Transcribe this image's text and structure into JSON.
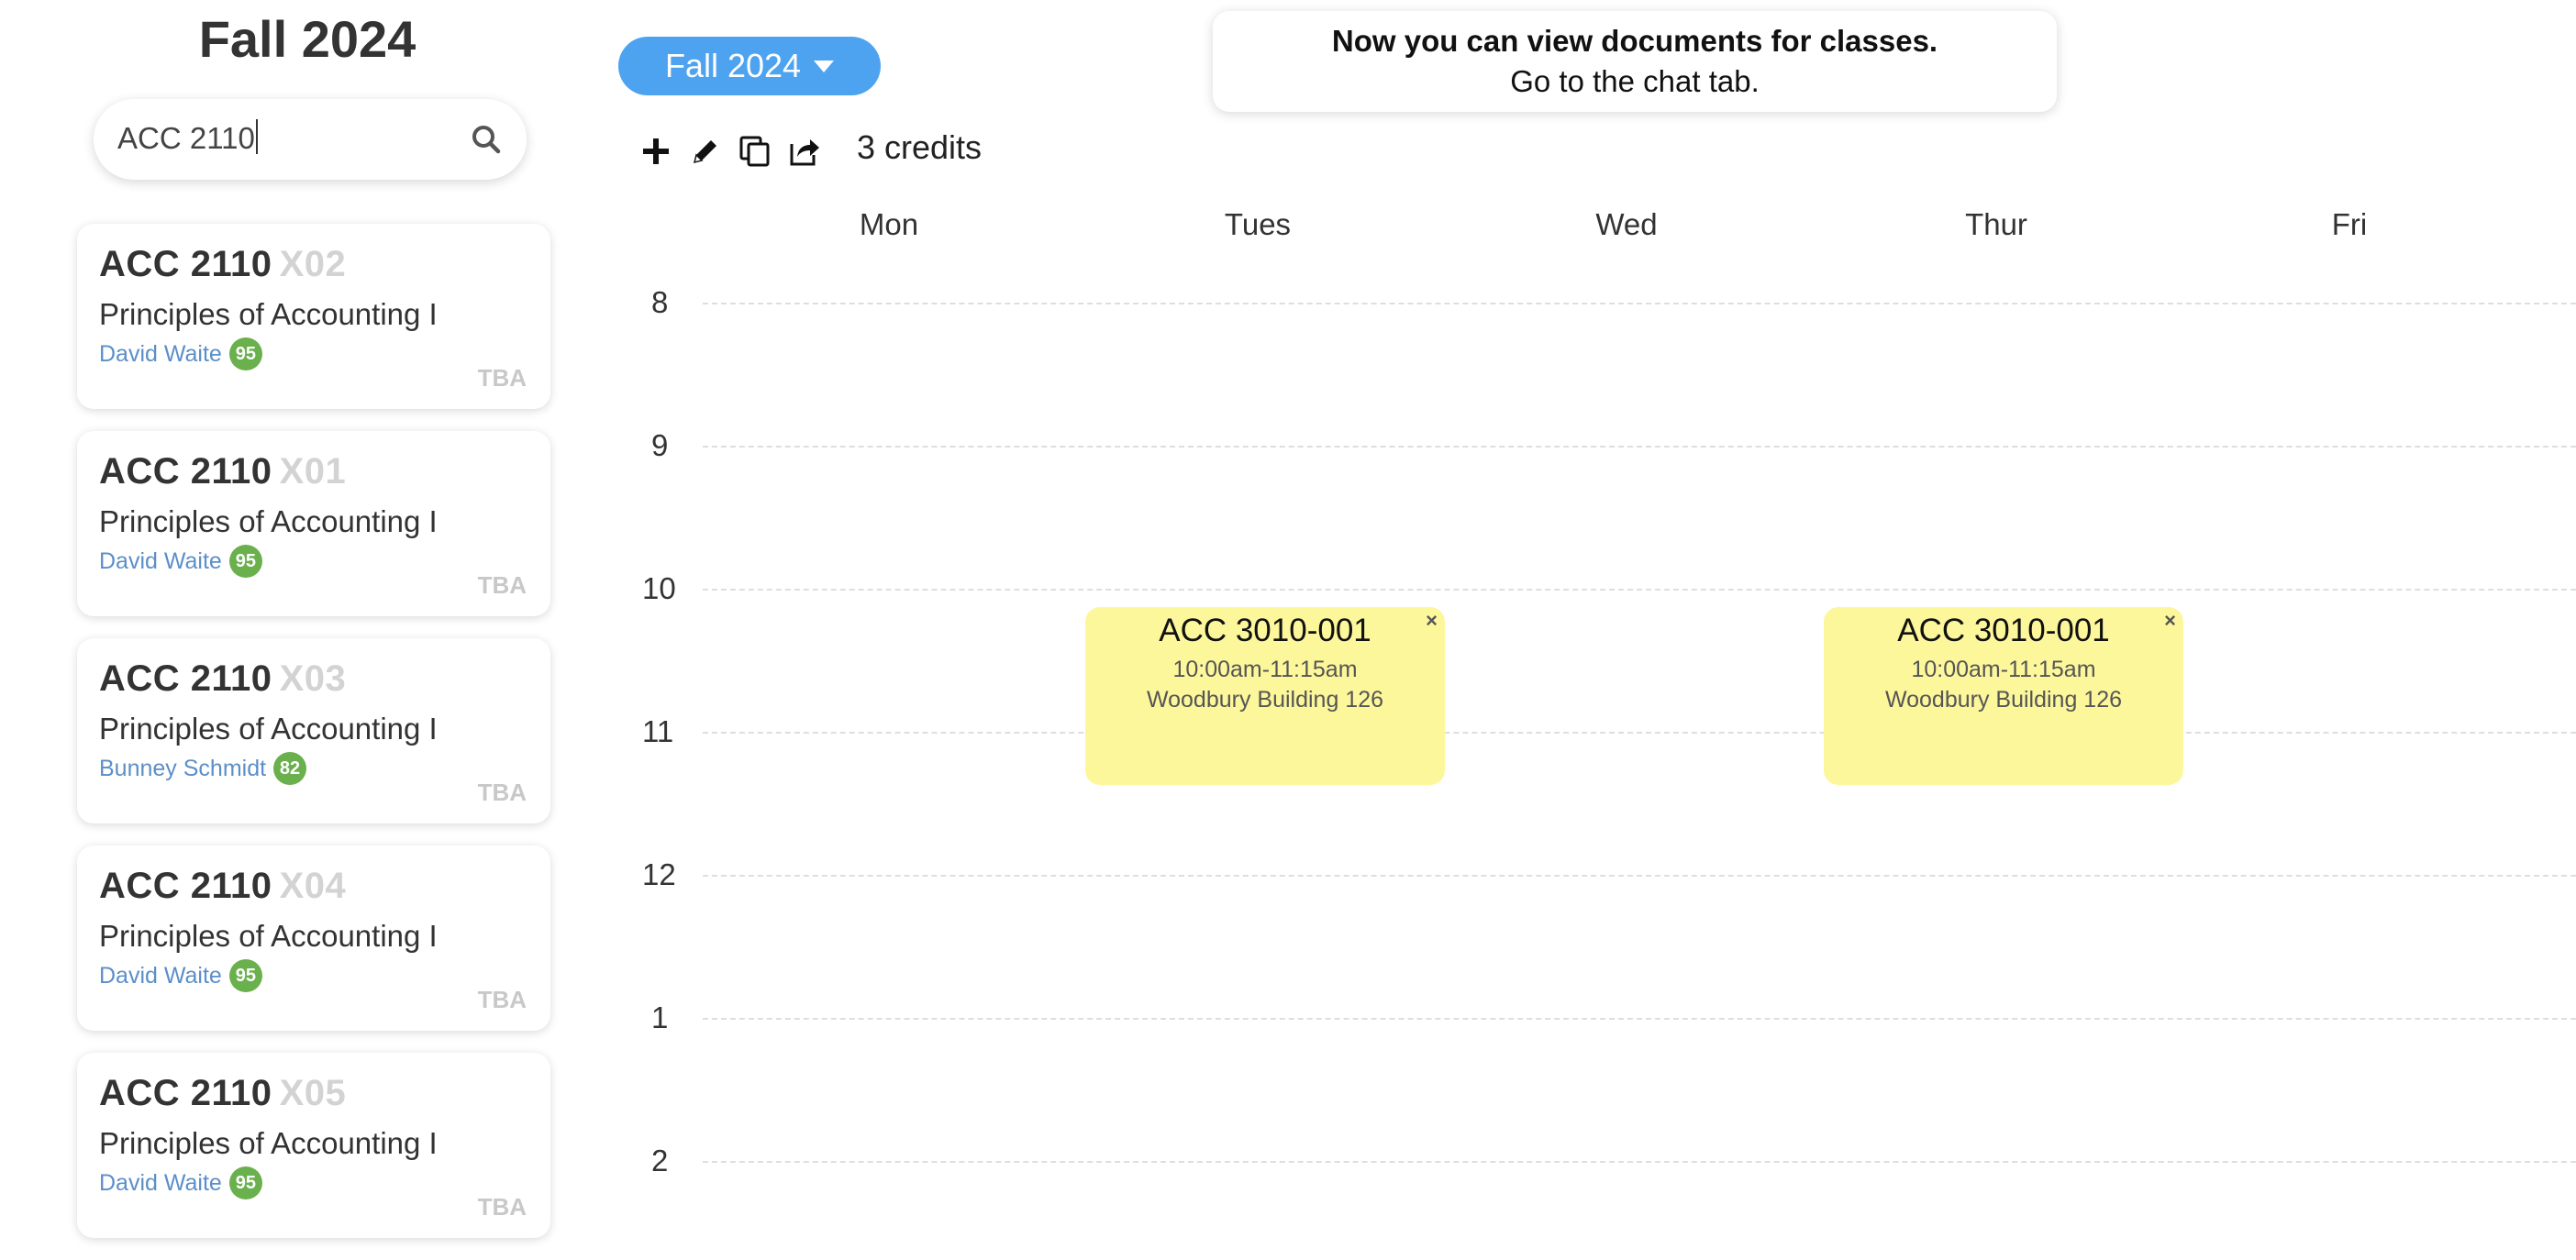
{
  "sidebar": {
    "title": "Fall 2024",
    "search": {
      "value": "ACC 2110",
      "icon": "search-icon"
    },
    "courses": [
      {
        "code": "ACC 2110",
        "section": "X02",
        "name": "Principles of Accounting I",
        "instructor": "David Waite",
        "rating": "95",
        "time": "TBA"
      },
      {
        "code": "ACC 2110",
        "section": "X01",
        "name": "Principles of Accounting I",
        "instructor": "David Waite",
        "rating": "95",
        "time": "TBA"
      },
      {
        "code": "ACC 2110",
        "section": "X03",
        "name": "Principles of Accounting I",
        "instructor": "Bunney Schmidt",
        "rating": "82",
        "time": "TBA"
      },
      {
        "code": "ACC 2110",
        "section": "X04",
        "name": "Principles of Accounting I",
        "instructor": "David Waite",
        "rating": "95",
        "time": "TBA"
      },
      {
        "code": "ACC 2110",
        "section": "X05",
        "name": "Principles of Accounting I",
        "instructor": "David Waite",
        "rating": "95",
        "time": "TBA"
      }
    ]
  },
  "header": {
    "term": "Fall 2024",
    "notice": {
      "line1": "Now you can view documents for classes.",
      "line2": "Go to the chat tab."
    }
  },
  "toolbar": {
    "icons": [
      "plus-icon",
      "pencil-icon",
      "copy-icon",
      "share-icon"
    ],
    "credits": "3 credits"
  },
  "calendar": {
    "days": [
      "Mon",
      "Tues",
      "Wed",
      "Thur",
      "Fri"
    ],
    "hours": [
      "8",
      "9",
      "10",
      "11",
      "12",
      "1",
      "2"
    ],
    "events": [
      {
        "title": "ACC 3010-001",
        "time": "10:00am-11:15am",
        "location": "Woodbury Building 126",
        "day": "Tues",
        "close": "×"
      },
      {
        "title": "ACC 3010-001",
        "time": "10:00am-11:15am",
        "location": "Woodbury Building 126",
        "day": "Thur",
        "close": "×"
      }
    ]
  },
  "colors": {
    "accent": "#4da3f0",
    "event": "#fdf79b",
    "rating": "#6ab04c",
    "instructor": "#5b8fc9"
  }
}
